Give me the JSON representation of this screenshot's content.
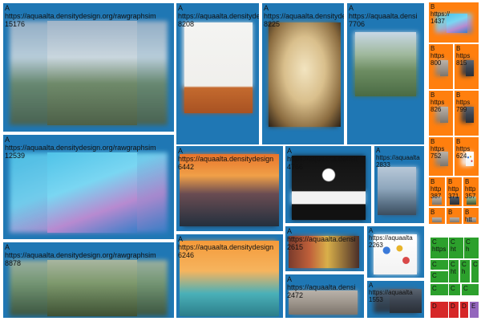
{
  "chart_data": {
    "type": "treemap",
    "groups": [
      {
        "name": "A",
        "color": "#1f77b4"
      },
      {
        "name": "B",
        "color": "#ff7f0e"
      },
      {
        "name": "C",
        "color": "#2ca02c"
      },
      {
        "name": "D",
        "color": "#d62728"
      },
      {
        "name": "E",
        "color": "#9467bd"
      }
    ],
    "items": [
      {
        "group": "A",
        "url": "https://aquaalta.densitydesign.org/rawgraphsim",
        "value": 15176,
        "art": "city"
      },
      {
        "group": "A",
        "url": "https://aquaalta.densitydesign.org/rawgraphsim",
        "value": 12539,
        "art": "bubbles"
      },
      {
        "group": "A",
        "url": "https://aquaalta.densitydesign.org/rawgraphsim",
        "value": 8878,
        "art": "valley"
      },
      {
        "group": "A",
        "url": "https://aquaalta.densitydesign.org",
        "value": 8208,
        "art": "twins"
      },
      {
        "group": "A",
        "url": "https://aquaalta.densitydesign.org",
        "value": 8225,
        "art": "desert"
      },
      {
        "group": "A",
        "url": "https://aquaalta.densi",
        "value": 7706,
        "art": "aerial"
      },
      {
        "group": "A",
        "url": "https://aquaalta.densitydesign",
        "value": 6442,
        "art": "sunset"
      },
      {
        "group": "A",
        "url": "https://aquaalta.densitydesign",
        "value": 6246,
        "art": "astronaut"
      },
      {
        "group": "A",
        "url": "https://aquaalta.densit",
        "value": 4766,
        "art": "sign"
      },
      {
        "group": "A",
        "url": "https://aquaalta",
        "value": 2833,
        "art": "towers"
      },
      {
        "group": "A",
        "url": "https://aquaalta.densi",
        "value": 2615,
        "art": "shelves"
      },
      {
        "group": "A",
        "url": "https://aquaalta",
        "value": 2263,
        "art": "icons"
      },
      {
        "group": "A",
        "url": "https://aquaalta.densi",
        "value": 2472,
        "art": "room"
      },
      {
        "group": "A",
        "url": "https://aquaalta",
        "value": 1553,
        "art": "street"
      },
      {
        "group": "B",
        "url": "https://",
        "value": 1437,
        "art": "bubbles"
      },
      {
        "group": "B",
        "url": "https",
        "value": 800,
        "art": "room"
      },
      {
        "group": "B",
        "url": "https",
        "value": 815,
        "art": "street"
      },
      {
        "group": "B",
        "url": "https",
        "value": 826,
        "art": "room"
      },
      {
        "group": "B",
        "url": "https",
        "value": 799,
        "art": "street"
      },
      {
        "group": "B",
        "url": "https",
        "value": 752,
        "art": "room"
      },
      {
        "group": "B",
        "url": "https",
        "value": 624,
        "art": "icons"
      },
      {
        "group": "B",
        "url": "http",
        "value": 387,
        "art": "room"
      },
      {
        "group": "B",
        "url": "http",
        "value": 371,
        "art": "street"
      },
      {
        "group": "B",
        "url": "http",
        "value": 357,
        "art": "valley"
      },
      {
        "group": "B",
        "url": "htt",
        "value": 262,
        "art": "room"
      },
      {
        "group": "B",
        "url": "",
        "value": null,
        "art": "room"
      },
      {
        "group": "B",
        "url": "",
        "value": null,
        "art": "room"
      },
      {
        "group": "C",
        "url": "https",
        "value": null,
        "art": "none"
      },
      {
        "group": "C",
        "url": "ht",
        "value": null,
        "art": "none"
      },
      {
        "group": "C",
        "url": "h",
        "value": null,
        "art": "none"
      },
      {
        "group": "C",
        "url": "h",
        "value": null,
        "art": "none"
      },
      {
        "group": "C",
        "url": "",
        "value": null,
        "art": "none"
      },
      {
        "group": "C",
        "url": "ht",
        "value": null,
        "art": "none"
      },
      {
        "group": "C",
        "url": "h",
        "value": null,
        "art": "none"
      },
      {
        "group": "C",
        "url": "",
        "value": null,
        "art": "none"
      },
      {
        "group": "C",
        "url": "",
        "value": null,
        "art": "none"
      },
      {
        "group": "C",
        "url": "",
        "value": null,
        "art": "none"
      },
      {
        "group": "C",
        "url": "",
        "value": null,
        "art": "none"
      },
      {
        "group": "C",
        "url": "",
        "value": null,
        "art": "none"
      },
      {
        "group": "D",
        "url": "",
        "value": null,
        "art": "none"
      },
      {
        "group": "D",
        "url": "",
        "value": null,
        "art": "none"
      },
      {
        "group": "D",
        "url": "",
        "value": null,
        "art": "none"
      },
      {
        "group": "E",
        "url": "",
        "value": null,
        "art": "none"
      },
      {
        "group": "E",
        "url": "",
        "value": null,
        "art": "none"
      },
      {
        "group": "E",
        "url": "",
        "value": null,
        "art": "none"
      }
    ]
  }
}
